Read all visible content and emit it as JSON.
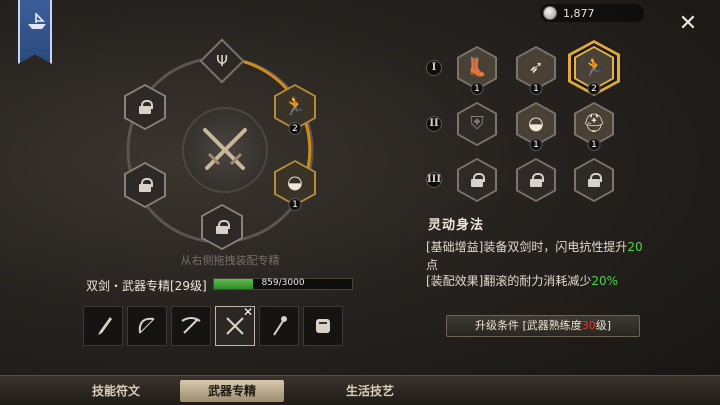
{
  "currency": {
    "icon": "silver-coin-icon",
    "amount": "1,877"
  },
  "wheel": {
    "hint": "从右侧拖拽装配专精",
    "slots": [
      {
        "name": "top-left",
        "state": "locked"
      },
      {
        "name": "left",
        "state": "locked"
      },
      {
        "name": "bottom",
        "state": "locked"
      },
      {
        "name": "right-upper",
        "state": "equipped",
        "icon": "runner-skill-icon",
        "level": "2"
      },
      {
        "name": "right-lower",
        "state": "equipped",
        "icon": "roll-skill-icon",
        "level": "1"
      }
    ]
  },
  "mastery": {
    "label": "双剑・武器专精[29级]",
    "xp_text": "859/3000",
    "xp_progress": 0.286
  },
  "weapons": [
    {
      "icon": "dagger-icon"
    },
    {
      "icon": "bow-icon"
    },
    {
      "icon": "crossbow-icon"
    },
    {
      "icon": "dual-swords-icon",
      "selected": true
    },
    {
      "icon": "torch-icon"
    },
    {
      "icon": "gauntlet-icon"
    }
  ],
  "tiers": {
    "t1": "I",
    "t2": "II",
    "t3": "III"
  },
  "skills": {
    "r1": [
      {
        "icon": "boot-skill-icon",
        "level": "1"
      },
      {
        "icon": "dash-skill-icon",
        "level": "1"
      },
      {
        "icon": "runner-skill-icon",
        "level": "2",
        "selected": true
      }
    ],
    "r2": [
      {
        "icon": "shield-skill-icon"
      },
      {
        "icon": "roll-skill-icon",
        "level": "1"
      },
      {
        "icon": "helmet-skill-icon",
        "level": "1"
      }
    ]
  },
  "detail": {
    "title": "灵动身法",
    "line1_prefix": "[基础增益]装备双剑时，闪电抗性提升",
    "line1_value": "20",
    "line1_suffix": "点",
    "line2_prefix": "[装配效果]翻滚的耐力消耗减少",
    "line2_value": "20%",
    "req_prefix": "升级条件 [武器熟练度",
    "req_value": "30",
    "req_suffix": "级]"
  },
  "tabs": [
    {
      "label": "技能符文",
      "active": false
    },
    {
      "label": "武器专精",
      "active": true
    },
    {
      "label": "生活技艺",
      "active": false
    }
  ]
}
